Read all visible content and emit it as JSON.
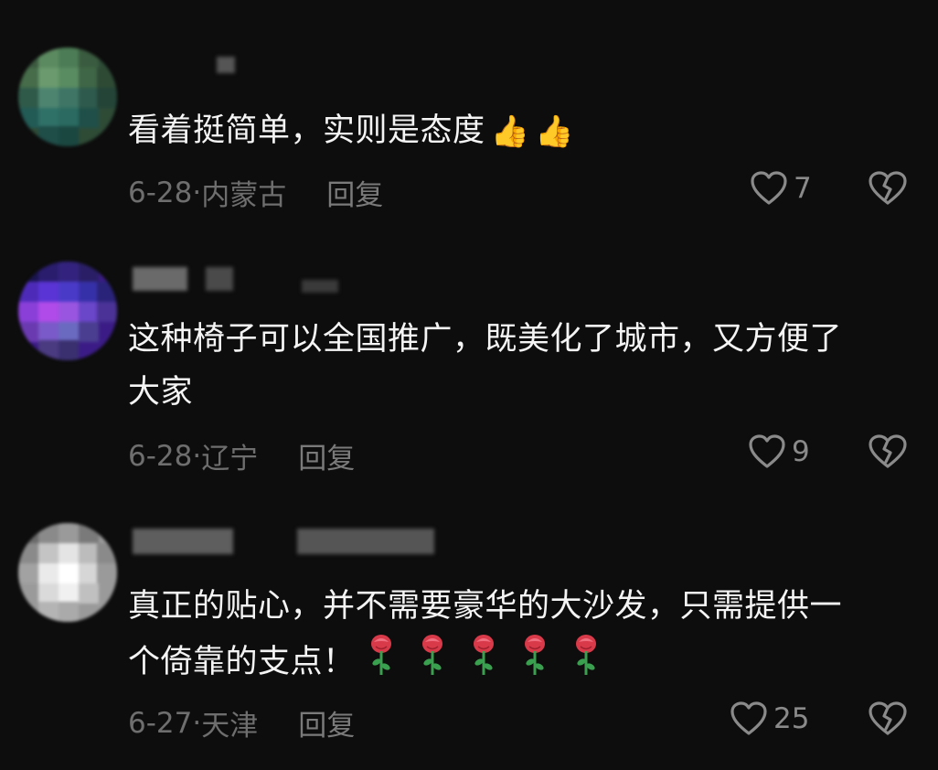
{
  "comments": [
    {
      "text": "看着挺简单，实则是态度",
      "emoji": [
        "👍",
        "👍"
      ],
      "date": "6-28",
      "location": "内蒙古",
      "reply_label": "回复",
      "likes": "7"
    },
    {
      "text": "这种椅子可以全国推广，既美化了城市，又方便了\n大家",
      "date": "6-28",
      "location": "辽宁",
      "reply_label": "回复",
      "likes": "9"
    },
    {
      "text": "真正的贴心，并不需要豪华的大沙发，只需提供一\n个倚靠的支点！",
      "rose_count": 5,
      "date": "6-27",
      "location": "天津",
      "reply_label": "回复",
      "likes": "25"
    }
  ],
  "colors": {
    "background": "#0d0d0d",
    "text": "#f4f4f4",
    "meta": "#6e6e6e",
    "icon": "#8a8a8a"
  },
  "icons": {
    "like": "heart-outline-icon",
    "dislike": "broken-heart-icon",
    "emoji": "thumbs-up-emoji",
    "rose": "rose-emoji"
  }
}
